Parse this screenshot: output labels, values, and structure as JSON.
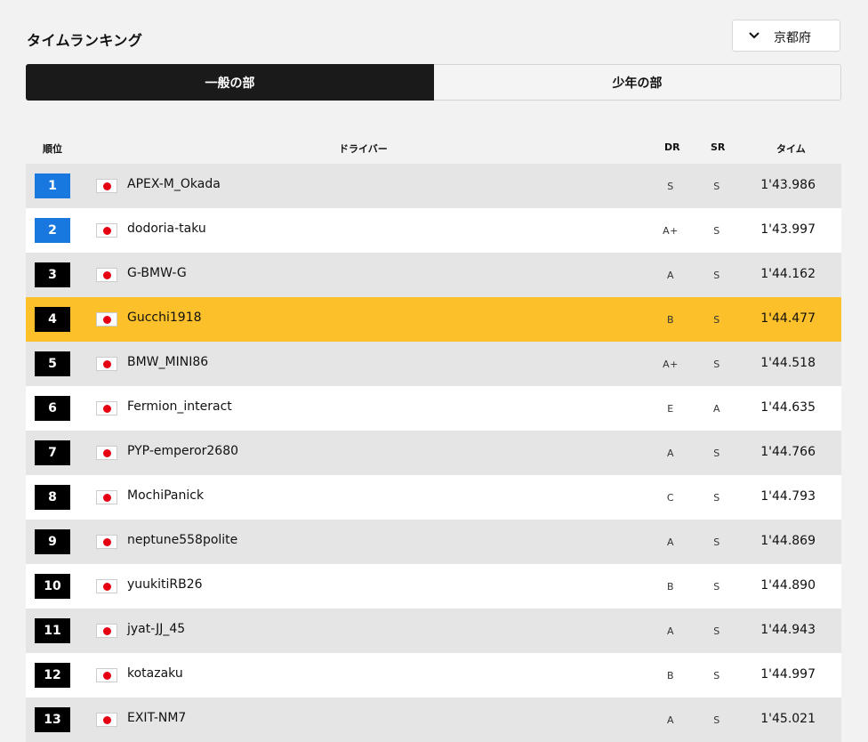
{
  "header": {
    "title": "タイムランキング"
  },
  "region_select": {
    "selected": "京都府",
    "icon": "chevron-down-icon"
  },
  "tabs": [
    {
      "label": "一般の部",
      "active": true
    },
    {
      "label": "少年の部",
      "active": false
    }
  ],
  "columns": {
    "rank": "順位",
    "driver": "ドライバー",
    "dr": "DR",
    "sr": "SR",
    "time": "タイム"
  },
  "colors": {
    "rank_top": "#1978e0",
    "rank_default": "#000000",
    "highlight": "#fcc02a",
    "row_alt": "#e5e5e5"
  },
  "rows": [
    {
      "rank": "1",
      "country": "Japan",
      "name": "APEX-M_Okada",
      "dr": "S",
      "sr": "S",
      "time": "1'43.986"
    },
    {
      "rank": "2",
      "country": "Japan",
      "name": "dodoria-taku",
      "dr": "A+",
      "sr": "S",
      "time": "1'43.997"
    },
    {
      "rank": "3",
      "country": "Japan",
      "name": "G-BMW-G",
      "dr": "A",
      "sr": "S",
      "time": "1'44.162"
    },
    {
      "rank": "4",
      "country": "Japan",
      "name": "Gucchi1918",
      "dr": "B",
      "sr": "S",
      "time": "1'44.477"
    },
    {
      "rank": "5",
      "country": "Japan",
      "name": "BMW_MINI86",
      "dr": "A+",
      "sr": "S",
      "time": "1'44.518"
    },
    {
      "rank": "6",
      "country": "Japan",
      "name": "Fermion_interact",
      "dr": "E",
      "sr": "A",
      "time": "1'44.635"
    },
    {
      "rank": "7",
      "country": "Japan",
      "name": "PYP-emperor2680",
      "dr": "A",
      "sr": "S",
      "time": "1'44.766"
    },
    {
      "rank": "8",
      "country": "Japan",
      "name": "MochiPanick",
      "dr": "C",
      "sr": "S",
      "time": "1'44.793"
    },
    {
      "rank": "9",
      "country": "Japan",
      "name": "neptune558polite",
      "dr": "A",
      "sr": "S",
      "time": "1'44.869"
    },
    {
      "rank": "10",
      "country": "Japan",
      "name": "yuukitiRB26",
      "dr": "B",
      "sr": "S",
      "time": "1'44.890"
    },
    {
      "rank": "11",
      "country": "Japan",
      "name": "jyat-JJ_45",
      "dr": "A",
      "sr": "S",
      "time": "1'44.943"
    },
    {
      "rank": "12",
      "country": "Japan",
      "name": "kotazaku",
      "dr": "B",
      "sr": "S",
      "time": "1'44.997"
    },
    {
      "rank": "13",
      "country": "Japan",
      "name": "EXIT-NM7",
      "dr": "A",
      "sr": "S",
      "time": "1'45.021"
    }
  ]
}
